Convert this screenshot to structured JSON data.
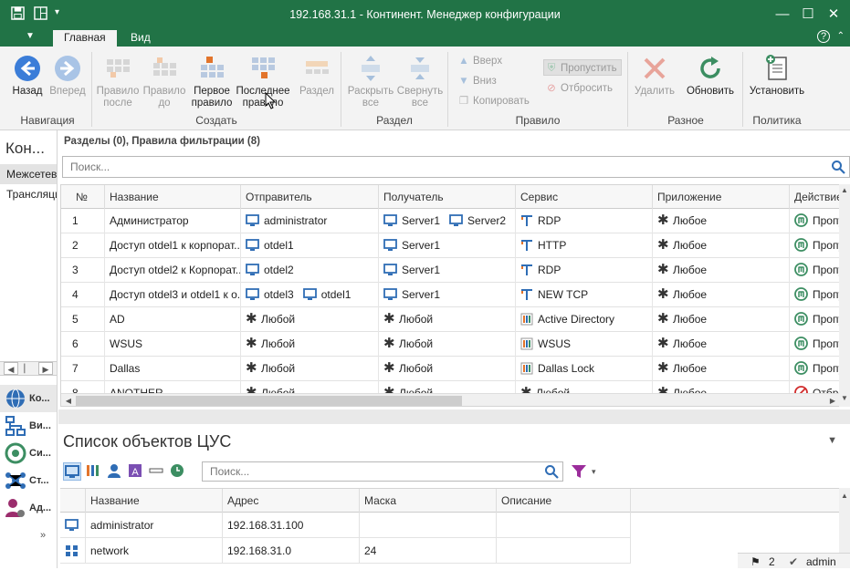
{
  "window": {
    "title": "192.168.31.1 - Континент. Менеджер конфигурации",
    "accent": "#217346"
  },
  "ribbon_tabs": [
    {
      "label": "Главная",
      "active": true
    },
    {
      "label": "Вид",
      "active": false
    }
  ],
  "ribbon": {
    "nav": {
      "back": "Назад",
      "forward": "Вперед",
      "group": "Навигация"
    },
    "create": {
      "after_line1": "Правило",
      "after_line2": "после",
      "before_line1": "Правило",
      "before_line2": "до",
      "first_line1": "Первое",
      "first_line2": "правило",
      "last_line1": "Последнее",
      "last_line2": "правило",
      "section": "Раздел",
      "group": "Создать"
    },
    "section": {
      "expand_line1": "Раскрыть",
      "expand_line2": "все",
      "collapse_line1": "Свернуть",
      "collapse_line2": "все",
      "group": "Раздел"
    },
    "rule": {
      "up": "Вверх",
      "down": "Вниз",
      "copy": "Копировать",
      "allow": "Пропустить",
      "drop": "Отбросить",
      "group": "Правило"
    },
    "misc": {
      "delete": "Удалить",
      "refresh": "Обновить",
      "group": "Разное"
    },
    "policy": {
      "install": "Установить",
      "group": "Политика"
    }
  },
  "left_panel": {
    "header": "Кон...",
    "items": [
      "Межсетевой экран",
      "Трансляция"
    ],
    "modules": [
      "Ко...",
      "Ви...",
      "Си...",
      "Ст...",
      "Ад..."
    ]
  },
  "main": {
    "caption": "Разделы (0), Правила фильтрации (8)",
    "search_placeholder": "Поиск..."
  },
  "rules_table": {
    "columns": [
      "№",
      "Название",
      "Отправитель",
      "Получатель",
      "Сервис",
      "Приложение",
      "Действие"
    ],
    "rows": [
      {
        "n": "1",
        "name": "Администратор",
        "sender": [
          "administrator"
        ],
        "receiver": [
          "Server1",
          "Server2"
        ],
        "service": "RDP",
        "service_icon": "service",
        "app": "Любое",
        "action": "Пропустить",
        "action_icon": "allow"
      },
      {
        "n": "2",
        "name": "Доступ otdel1 к корпорат...",
        "sender": [
          "otdel1"
        ],
        "receiver": [
          "Server1"
        ],
        "service": "HTTP",
        "service_icon": "service",
        "app": "Любое",
        "action": "Пропустить",
        "action_icon": "allow"
      },
      {
        "n": "3",
        "name": "Доступ otdel2 к Корпорат...",
        "sender": [
          "otdel2"
        ],
        "receiver": [
          "Server1"
        ],
        "service": "RDP",
        "service_icon": "service",
        "app": "Любое",
        "action": "Пропустить",
        "action_icon": "allow"
      },
      {
        "n": "4",
        "name": "Доступ otdel3 и otdel1 к о...",
        "sender": [
          "otdel3",
          "otdel1"
        ],
        "receiver": [
          "Server1"
        ],
        "service": "NEW TCP",
        "service_icon": "service",
        "app": "Любое",
        "action": "Пропустить",
        "action_icon": "allow"
      },
      {
        "n": "5",
        "name": "AD",
        "sender": [],
        "sender_any": "Любой",
        "receiver": [],
        "receiver_any": "Любой",
        "service": "Active Directory",
        "service_icon": "group",
        "app": "Любое",
        "action": "Пропустить",
        "action_icon": "allow"
      },
      {
        "n": "6",
        "name": "WSUS",
        "sender": [],
        "sender_any": "Любой",
        "receiver": [],
        "receiver_any": "Любой",
        "service": "WSUS",
        "service_icon": "group",
        "app": "Любое",
        "action": "Пропустить",
        "action_icon": "allow"
      },
      {
        "n": "7",
        "name": "Dallas",
        "sender": [],
        "sender_any": "Любой",
        "receiver": [],
        "receiver_any": "Любой",
        "service": "Dallas Lock",
        "service_icon": "group",
        "app": "Любое",
        "action": "Пропустить",
        "action_icon": "allow"
      },
      {
        "n": "8",
        "name": "ANOTHER",
        "sender": [],
        "sender_any": "Любой",
        "receiver": [],
        "receiver_any": "Любой",
        "service": "Любой",
        "service_icon": "any",
        "app": "Любое",
        "action": "Отбросить",
        "action_icon": "drop"
      }
    ]
  },
  "objects_panel": {
    "title": "Список объектов ЦУС",
    "search_placeholder": "Поиск...",
    "columns": [
      "Название",
      "Адрес",
      "Маска",
      "Описание"
    ],
    "rows": [
      {
        "name": "administrator",
        "address": "192.168.31.100",
        "mask": "",
        "desc": "",
        "icon": "computer"
      },
      {
        "name": "network",
        "address": "192.168.31.0",
        "mask": "24",
        "desc": "",
        "icon": "network"
      }
    ]
  },
  "status": {
    "flags": "2",
    "user": "admin"
  }
}
